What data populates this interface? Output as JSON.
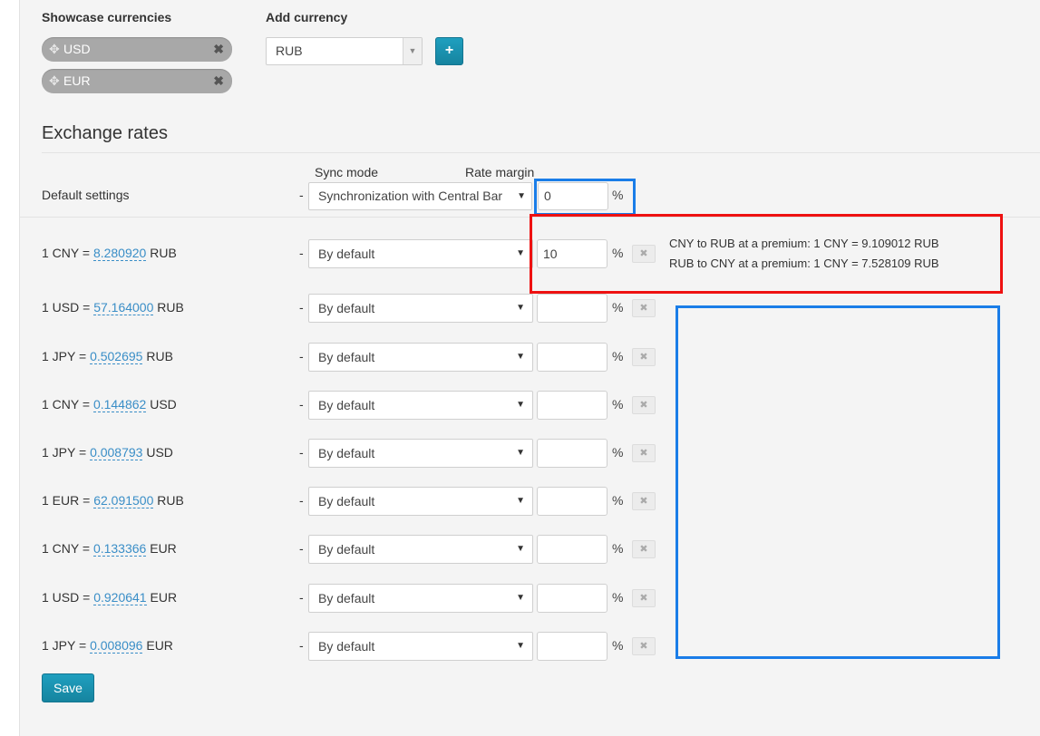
{
  "showcase": {
    "title": "Showcase currencies",
    "chips": [
      {
        "code": "USD"
      },
      {
        "code": "EUR"
      }
    ]
  },
  "add_currency": {
    "title": "Add currency",
    "selected": "RUB",
    "button_label": "+"
  },
  "exchange": {
    "title": "Exchange rates",
    "col_sync_mode": "Sync mode",
    "col_rate_margin": "Rate margin",
    "default_label": "Default settings",
    "default_mode": "Synchronization with Central Bar",
    "default_margin": "0",
    "percent": "%",
    "dash": "-",
    "remove_glyph": "✖",
    "rows": [
      {
        "from": "1 CNY =",
        "rate": "8.280920",
        "to": "RUB",
        "mode": "By default",
        "margin": "10"
      },
      {
        "from": "1 USD =",
        "rate": "57.164000",
        "to": "RUB",
        "mode": "By default",
        "margin": ""
      },
      {
        "from": "1 JPY =",
        "rate": "0.502695",
        "to": "RUB",
        "mode": "By default",
        "margin": ""
      },
      {
        "from": "1 CNY =",
        "rate": "0.144862",
        "to": "USD",
        "mode": "By default",
        "margin": ""
      },
      {
        "from": "1 JPY =",
        "rate": "0.008793",
        "to": "USD",
        "mode": "By default",
        "margin": ""
      },
      {
        "from": "1 EUR =",
        "rate": "62.091500",
        "to": "RUB",
        "mode": "By default",
        "margin": ""
      },
      {
        "from": "1 CNY =",
        "rate": "0.133366",
        "to": "EUR",
        "mode": "By default",
        "margin": ""
      },
      {
        "from": "1 USD =",
        "rate": "0.920641",
        "to": "EUR",
        "mode": "By default",
        "margin": ""
      },
      {
        "from": "1 JPY =",
        "rate": "0.008096",
        "to": "EUR",
        "mode": "By default",
        "margin": ""
      }
    ],
    "premium_lines": [
      "CNY to RUB at a premium: 1 CNY = 9.109012 RUB",
      "RUB to CNY at a premium: 1 CNY = 7.528109 RUB"
    ]
  },
  "save_label": "Save",
  "colors": {
    "accent": "#1a8fb0",
    "link": "#3a8ec7",
    "highlight_red": "#ee1111",
    "highlight_blue": "#1a7de8"
  },
  "icons": {
    "chip_remove": "close-icon",
    "chip_drag": "move-icon",
    "select_arrow": "caret-down-icon"
  }
}
